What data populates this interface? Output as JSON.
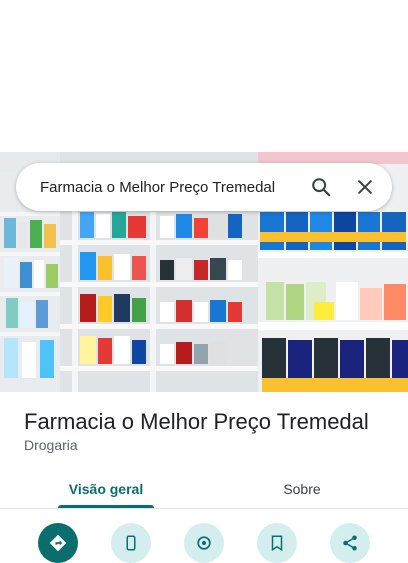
{
  "search": {
    "query": "Farmacia o Melhor Preço Tremedal"
  },
  "place": {
    "name": "Farmacia o Melhor Preço Tremedal",
    "category": "Drogaria"
  },
  "tabs": [
    {
      "label": "Visão geral",
      "active": true
    },
    {
      "label": "Sobre",
      "active": false
    }
  ],
  "actions": [
    {
      "icon": "directions-icon"
    },
    {
      "icon": "phone-icon"
    },
    {
      "icon": "location-icon"
    },
    {
      "icon": "save-icon"
    },
    {
      "icon": "share-icon"
    }
  ],
  "colors": {
    "accent": "#0b6e6e",
    "action_bg": "#d4eef0",
    "text": "#202124",
    "secondary_text": "#5f6368"
  }
}
